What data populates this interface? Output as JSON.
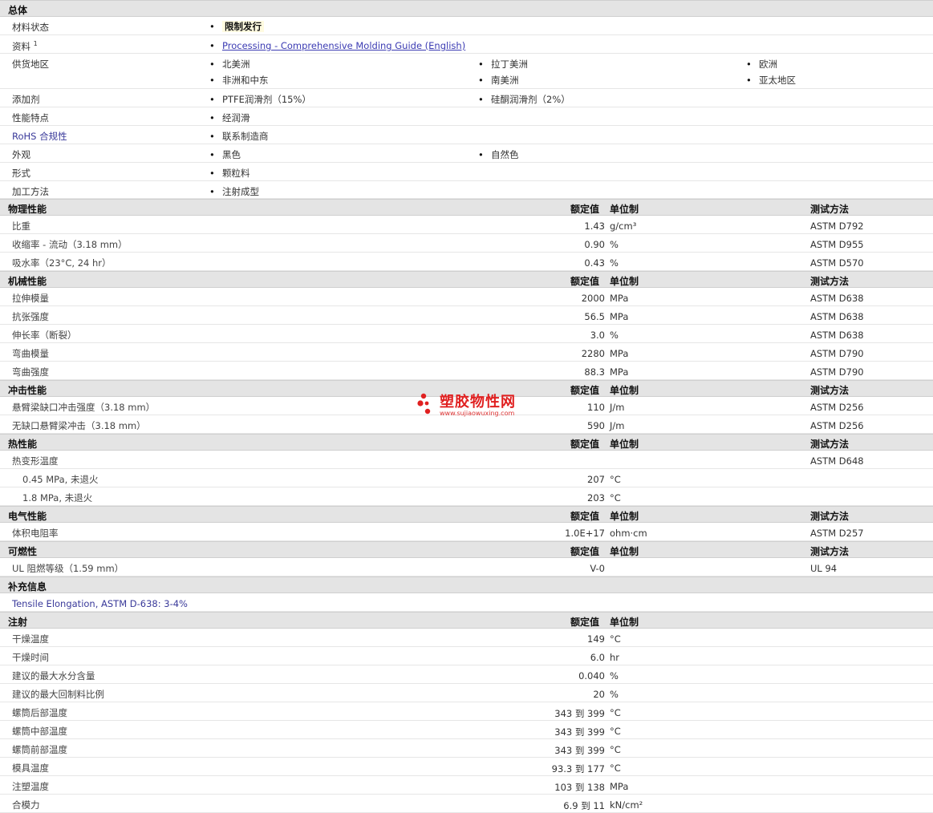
{
  "general": {
    "title": "总体",
    "status_label": "材料状态",
    "status_value": "限制发行",
    "docs_label": "资料",
    "docs_sup": "1",
    "docs_link": "Processing - Comprehensive Molding Guide (English)",
    "regions_label": "供货地区",
    "regions": [
      "北美洲",
      "拉丁美洲",
      "欧洲",
      "非洲和中东",
      "南美洲",
      "亚太地区"
    ],
    "additives_label": "添加剂",
    "additives": [
      "PTFE润滑剂（15%）",
      "硅酮润滑剂（2%）"
    ],
    "features_label": "性能特点",
    "features": "经润滑",
    "rohs_label": "RoHS 合规性",
    "rohs": "联系制造商",
    "appearance_label": "外观",
    "appearance": [
      "黑色",
      "自然色"
    ],
    "form_label": "形式",
    "form": "颗粒料",
    "process_label": "加工方法",
    "process": "注射成型"
  },
  "headers": {
    "nominal": "额定值",
    "unit": "单位制",
    "method": "测试方法"
  },
  "physical": {
    "title": "物理性能",
    "rows": [
      {
        "name": "比重",
        "value": "1.43",
        "unit": "g/cm³",
        "method": "ASTM D792"
      },
      {
        "name": "收缩率 - 流动（3.18 mm）",
        "value": "0.90",
        "unit": "%",
        "method": "ASTM D955"
      },
      {
        "name": "吸水率（23°C, 24 hr）",
        "value": "0.43",
        "unit": "%",
        "method": "ASTM D570"
      }
    ]
  },
  "mechanical": {
    "title": "机械性能",
    "rows": [
      {
        "name": "拉伸模量",
        "value": "2000",
        "unit": "MPa",
        "method": "ASTM D638"
      },
      {
        "name": "抗张强度",
        "value": "56.5",
        "unit": "MPa",
        "method": "ASTM D638"
      },
      {
        "name": "伸长率（断裂）",
        "value": "3.0",
        "unit": "%",
        "method": "ASTM D638"
      },
      {
        "name": "弯曲模量",
        "value": "2280",
        "unit": "MPa",
        "method": "ASTM D790"
      },
      {
        "name": "弯曲强度",
        "value": "88.3",
        "unit": "MPa",
        "method": "ASTM D790"
      }
    ]
  },
  "impact": {
    "title": "冲击性能",
    "rows": [
      {
        "name": "悬臂梁缺口冲击强度（3.18 mm）",
        "value": "110",
        "unit": "J/m",
        "method": "ASTM D256"
      },
      {
        "name": "无缺口悬臂梁冲击（3.18 mm）",
        "value": "590",
        "unit": "J/m",
        "method": "ASTM D256"
      }
    ]
  },
  "thermal": {
    "title": "热性能",
    "rows": [
      {
        "name": "热变形温度",
        "value": "",
        "unit": "",
        "method": "ASTM D648"
      },
      {
        "name": "0.45 MPa, 未退火",
        "value": "207",
        "unit": "°C",
        "method": ""
      },
      {
        "name": "1.8 MPa, 未退火",
        "value": "203",
        "unit": "°C",
        "method": ""
      }
    ]
  },
  "electrical": {
    "title": "电气性能",
    "rows": [
      {
        "name": "体积电阻率",
        "value": "1.0E+17",
        "unit": "ohm·cm",
        "method": "ASTM D257"
      }
    ]
  },
  "flammability": {
    "title": "可燃性",
    "rows": [
      {
        "name": "UL 阻燃等级（1.59 mm）",
        "value": "V-0",
        "unit": "",
        "method": "UL 94"
      }
    ]
  },
  "supplement": {
    "title": "补充信息",
    "text": "Tensile Elongation, ASTM D-638: 3-4%"
  },
  "injection": {
    "title": "注射",
    "rows": [
      {
        "name": "干燥温度",
        "value": "149",
        "unit": "°C"
      },
      {
        "name": "干燥时间",
        "value": "6.0",
        "unit": "hr"
      },
      {
        "name": "建议的最大水分含量",
        "value": "0.040",
        "unit": "%"
      },
      {
        "name": "建议的最大回制料比例",
        "value": "20",
        "unit": "%"
      },
      {
        "name": "螺筒后部温度",
        "value": "343 到  399",
        "unit": "°C"
      },
      {
        "name": "螺筒中部温度",
        "value": "343 到  399",
        "unit": "°C"
      },
      {
        "name": "螺筒前部温度",
        "value": "343 到  399",
        "unit": "°C"
      },
      {
        "name": "模具温度",
        "value": "93.3 到  177",
        "unit": "°C"
      },
      {
        "name": "注塑温度",
        "value": "103 到  138",
        "unit": "MPa"
      },
      {
        "name": "合模力",
        "value": "6.9 到  11",
        "unit": "kN/cm²"
      }
    ]
  },
  "watermark": {
    "name": "塑胶物性网",
    "url": "www.sujiaowuxing.com",
    "color": "#e02020"
  }
}
